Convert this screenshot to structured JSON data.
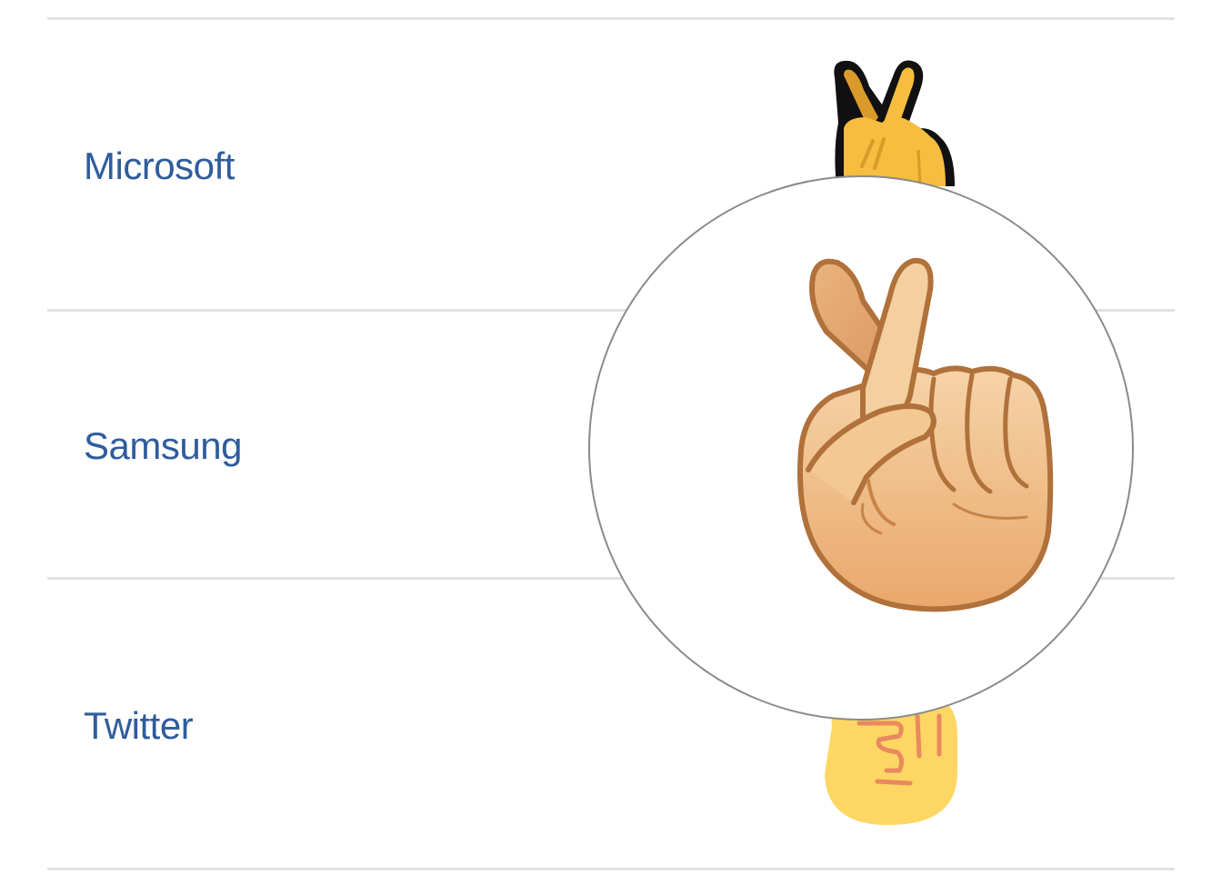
{
  "vendors": [
    {
      "name": "Microsoft",
      "emoji_icon": "crossed-fingers-microsoft-icon"
    },
    {
      "name": "Samsung",
      "emoji_icon": "crossed-fingers-samsung-icon"
    },
    {
      "name": "Twitter",
      "emoji_icon": "crossed-fingers-twitter-icon"
    }
  ],
  "magnifier": {
    "vendor": "Samsung",
    "emoji_icon": "crossed-fingers-samsung-icon"
  },
  "colors": {
    "link": "#2f5c9c",
    "divider": "#e2e2e2",
    "microsoft_skin": "#f6bd3f",
    "samsung_skin": "#f2c48e",
    "samsung_outline": "#b0713a",
    "twitter_skin": "#fdd663",
    "twitter_crease": "#e8895f"
  }
}
